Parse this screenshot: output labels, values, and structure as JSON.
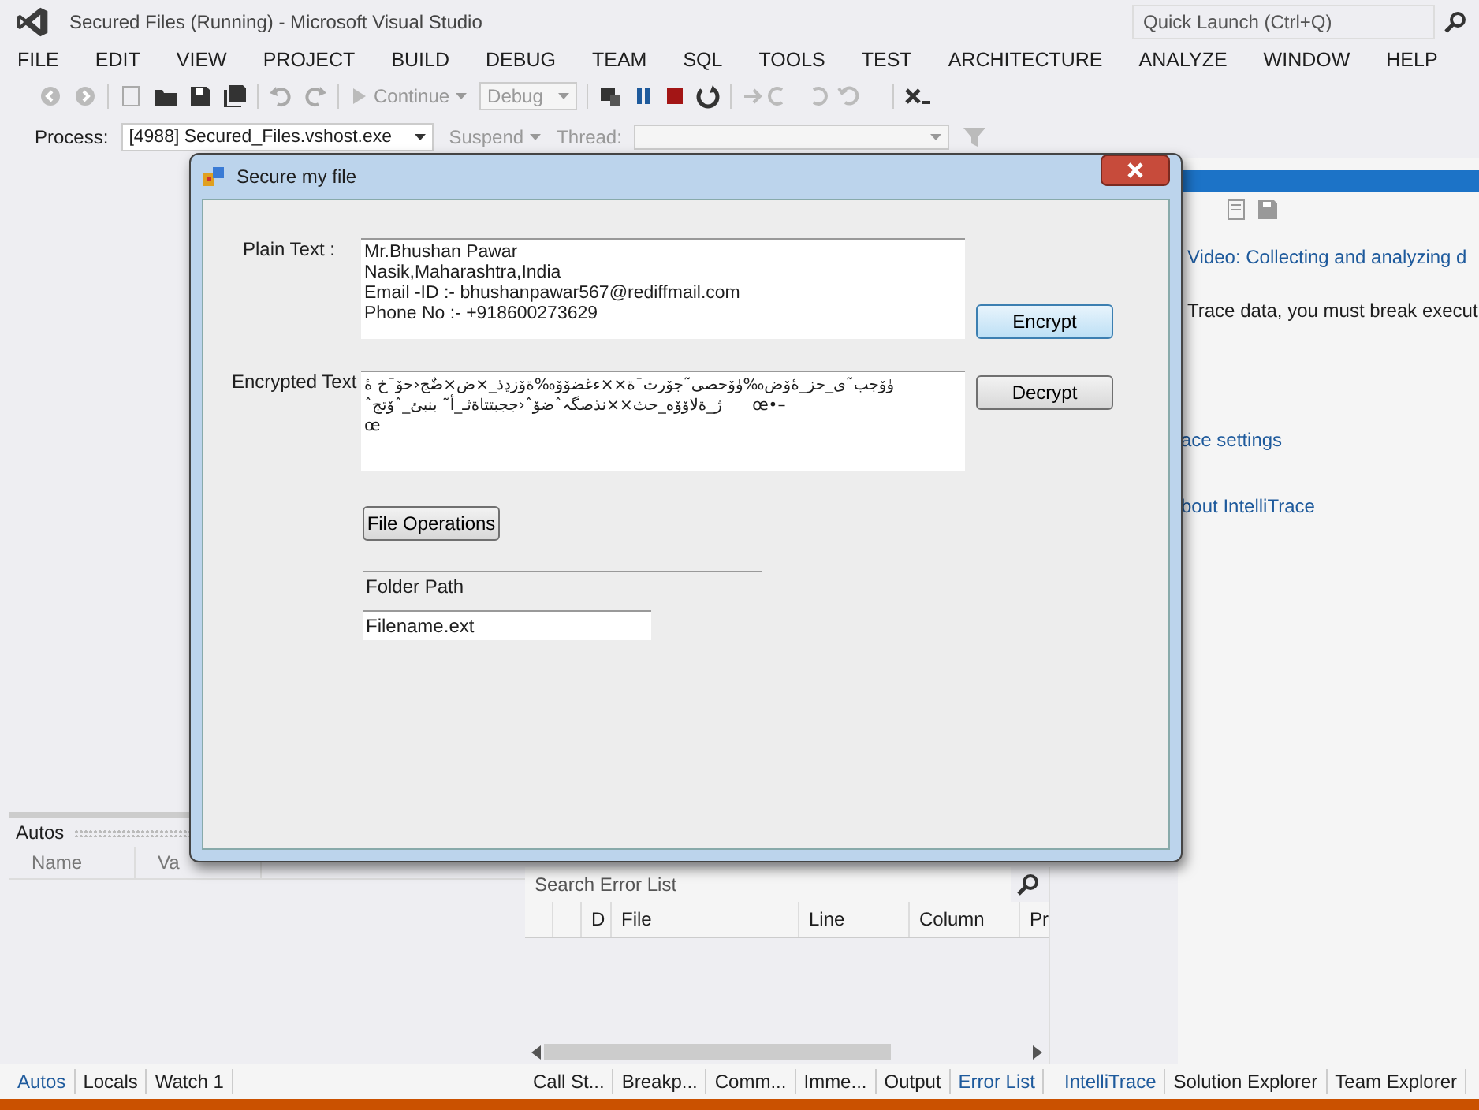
{
  "window": {
    "title": "Secured Files (Running) - Microsoft Visual Studio"
  },
  "quick_launch": {
    "placeholder": "Quick Launch (Ctrl+Q)"
  },
  "menu": [
    "FILE",
    "EDIT",
    "VIEW",
    "PROJECT",
    "BUILD",
    "DEBUG",
    "TEAM",
    "SQL",
    "TOOLS",
    "TEST",
    "ARCHITECTURE",
    "ANALYZE",
    "WINDOW",
    "HELP"
  ],
  "toolbar": {
    "continue": "Continue",
    "configuration": "Debug"
  },
  "process_bar": {
    "process_label": "Process:",
    "process": "[4988] Secured_Files.vshost.exe",
    "suspend": "Suspend",
    "thread_label": "Thread:"
  },
  "intellitrace": {
    "lines": [
      {
        "kind": "link",
        "text": "Video: Collecting and analyzing d"
      },
      {
        "kind": "text",
        "text": "Trace data, you must break execut"
      },
      {
        "kind": "link",
        "text": "ace settings"
      },
      {
        "kind": "link",
        "text": "bout IntelliTrace"
      }
    ]
  },
  "autos": {
    "title": "Autos",
    "columns": [
      "Name",
      "Va"
    ]
  },
  "error_list": {
    "search": {
      "placeholder": "Search Error List"
    },
    "columns": [
      "D",
      "File",
      "Line",
      "Column",
      "Pr"
    ]
  },
  "left_tabs": [
    {
      "label": "Autos",
      "selected": true
    },
    {
      "label": "Locals",
      "selected": false
    },
    {
      "label": "Watch 1",
      "selected": false
    }
  ],
  "bottom_tabs": [
    {
      "label": "Call St...",
      "selected": false
    },
    {
      "label": "Breakp...",
      "selected": false
    },
    {
      "label": "Comm...",
      "selected": false
    },
    {
      "label": "Imme...",
      "selected": false
    },
    {
      "label": "Output",
      "selected": false
    },
    {
      "label": "Error List",
      "selected": true
    }
  ],
  "right_tabs": [
    {
      "label": "IntelliTrace",
      "selected": true
    },
    {
      "label": "Solution Explorer",
      "selected": false
    },
    {
      "label": "Team Explorer",
      "selected": false
    }
  ],
  "dialog": {
    "title": "Secure my file",
    "plain_label": "Plain Text :",
    "plain_text": "Mr.Bhushan Pawar\nNasik,Maharashtra,India\nEmail -ID :- bhushanpawar567@rediffmail.com\nPhone No :- +918600273629",
    "encrypted_label": "Encrypted Text",
    "encrypted_text": "ۈۆجب˜ى_حز_ۀۆض‰ۈۆحصى˜جۆرث¯ة××ءغضۆۆ‰ةۆزڍذ_×ض×ضٌج‹حۆ¯خ ۀ\nˆژ_ةلاۆۆه_حث××نذصگہˆضۆˆ‹ججبتتاةثـ_أ˜ بنبئ_ˆۆتج      œ•–\nœ",
    "encrypt": {
      "label": "Encrypt",
      "focused": true
    },
    "decrypt": {
      "label": "Decrypt",
      "focused": false
    },
    "file_operations": "File Operations",
    "folder_path": "Folder Path",
    "filename": "Filename.ext"
  }
}
